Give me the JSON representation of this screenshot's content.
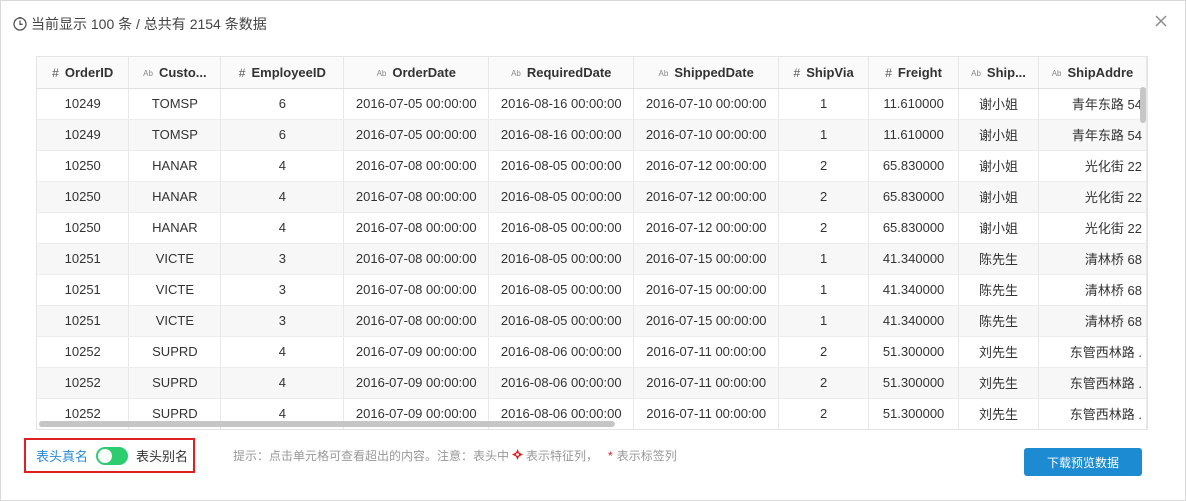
{
  "header": {
    "summary": "当前显示 100 条 / 总共有 2154 条数据"
  },
  "icons": {
    "clock": "clock-icon",
    "close": "close-icon"
  },
  "columns": [
    {
      "type": "#",
      "label": "OrderID"
    },
    {
      "type": "Ab",
      "label": "Custo..."
    },
    {
      "type": "#",
      "label": "EmployeeID"
    },
    {
      "type": "Ab",
      "label": "OrderDate"
    },
    {
      "type": "Ab",
      "label": "RequiredDate"
    },
    {
      "type": "Ab",
      "label": "ShippedDate"
    },
    {
      "type": "#",
      "label": "ShipVia"
    },
    {
      "type": "#",
      "label": "Freight"
    },
    {
      "type": "Ab",
      "label": "Ship..."
    },
    {
      "type": "Ab",
      "label": "ShipAddre"
    }
  ],
  "rows": [
    [
      "10249",
      "TOMSP",
      "6",
      "2016-07-05 00:00:00",
      "2016-08-16 00:00:00",
      "2016-07-10 00:00:00",
      "1",
      "11.610000",
      "谢小姐",
      "青年东路 54"
    ],
    [
      "10249",
      "TOMSP",
      "6",
      "2016-07-05 00:00:00",
      "2016-08-16 00:00:00",
      "2016-07-10 00:00:00",
      "1",
      "11.610000",
      "谢小姐",
      "青年东路 54"
    ],
    [
      "10250",
      "HANAR",
      "4",
      "2016-07-08 00:00:00",
      "2016-08-05 00:00:00",
      "2016-07-12 00:00:00",
      "2",
      "65.830000",
      "谢小姐",
      "光化街 22"
    ],
    [
      "10250",
      "HANAR",
      "4",
      "2016-07-08 00:00:00",
      "2016-08-05 00:00:00",
      "2016-07-12 00:00:00",
      "2",
      "65.830000",
      "谢小姐",
      "光化街 22"
    ],
    [
      "10250",
      "HANAR",
      "4",
      "2016-07-08 00:00:00",
      "2016-08-05 00:00:00",
      "2016-07-12 00:00:00",
      "2",
      "65.830000",
      "谢小姐",
      "光化街 22"
    ],
    [
      "10251",
      "VICTE",
      "3",
      "2016-07-08 00:00:00",
      "2016-08-05 00:00:00",
      "2016-07-15 00:00:00",
      "1",
      "41.340000",
      "陈先生",
      "清林桥 68"
    ],
    [
      "10251",
      "VICTE",
      "3",
      "2016-07-08 00:00:00",
      "2016-08-05 00:00:00",
      "2016-07-15 00:00:00",
      "1",
      "41.340000",
      "陈先生",
      "清林桥 68"
    ],
    [
      "10251",
      "VICTE",
      "3",
      "2016-07-08 00:00:00",
      "2016-08-05 00:00:00",
      "2016-07-15 00:00:00",
      "1",
      "41.340000",
      "陈先生",
      "清林桥 68"
    ],
    [
      "10252",
      "SUPRD",
      "4",
      "2016-07-09 00:00:00",
      "2016-08-06 00:00:00",
      "2016-07-11 00:00:00",
      "2",
      "51.300000",
      "刘先生",
      "东管西林路 ."
    ],
    [
      "10252",
      "SUPRD",
      "4",
      "2016-07-09 00:00:00",
      "2016-08-06 00:00:00",
      "2016-07-11 00:00:00",
      "2",
      "51.300000",
      "刘先生",
      "东管西林路 ."
    ],
    [
      "10252",
      "SUPRD",
      "4",
      "2016-07-09 00:00:00",
      "2016-08-06 00:00:00",
      "2016-07-11 00:00:00",
      "2",
      "51.300000",
      "刘先生",
      "东管西林路 ."
    ]
  ],
  "footer": {
    "real_name_label": "表头真名",
    "alias_label": "表头别名",
    "toggle_state": "on",
    "hint_prefix": "提示：点击单元格可查看超出的内容。注意：表头中",
    "hint_feature": "表示特征列，",
    "hint_star": "*",
    "hint_tag": "表示标签列",
    "download_label": "下载预览数据"
  },
  "colors": {
    "accent": "#1d8bd1",
    "toggle_on": "#2ecc71",
    "highlight_border": "#e02020"
  }
}
